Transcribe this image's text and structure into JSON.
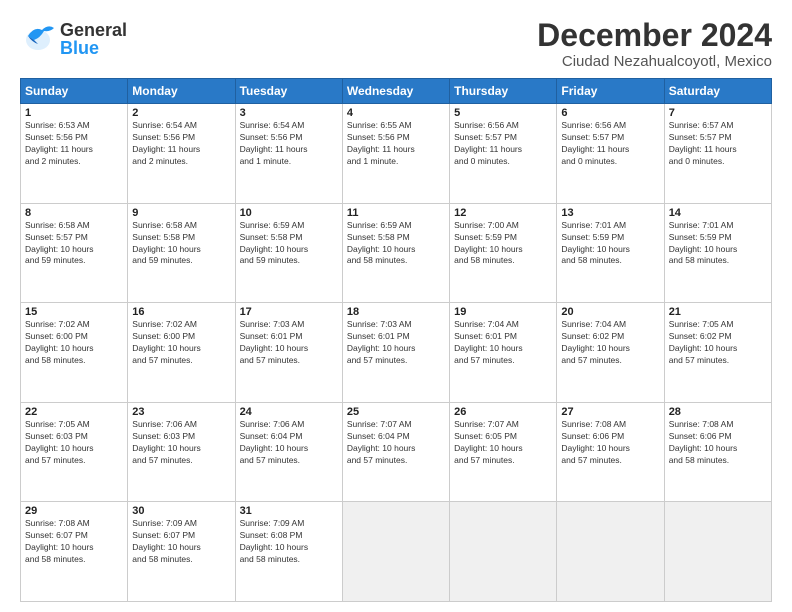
{
  "header": {
    "logo_general": "General",
    "logo_blue": "Blue",
    "main_title": "December 2024",
    "sub_title": "Ciudad Nezahualcoyotl, Mexico"
  },
  "calendar": {
    "headers": [
      "Sunday",
      "Monday",
      "Tuesday",
      "Wednesday",
      "Thursday",
      "Friday",
      "Saturday"
    ],
    "rows": [
      [
        {
          "day": "1",
          "info": "Sunrise: 6:53 AM\nSunset: 5:56 PM\nDaylight: 11 hours\nand 2 minutes."
        },
        {
          "day": "2",
          "info": "Sunrise: 6:54 AM\nSunset: 5:56 PM\nDaylight: 11 hours\nand 2 minutes."
        },
        {
          "day": "3",
          "info": "Sunrise: 6:54 AM\nSunset: 5:56 PM\nDaylight: 11 hours\nand 1 minute."
        },
        {
          "day": "4",
          "info": "Sunrise: 6:55 AM\nSunset: 5:56 PM\nDaylight: 11 hours\nand 1 minute."
        },
        {
          "day": "5",
          "info": "Sunrise: 6:56 AM\nSunset: 5:57 PM\nDaylight: 11 hours\nand 0 minutes."
        },
        {
          "day": "6",
          "info": "Sunrise: 6:56 AM\nSunset: 5:57 PM\nDaylight: 11 hours\nand 0 minutes."
        },
        {
          "day": "7",
          "info": "Sunrise: 6:57 AM\nSunset: 5:57 PM\nDaylight: 11 hours\nand 0 minutes."
        }
      ],
      [
        {
          "day": "8",
          "info": "Sunrise: 6:58 AM\nSunset: 5:57 PM\nDaylight: 10 hours\nand 59 minutes."
        },
        {
          "day": "9",
          "info": "Sunrise: 6:58 AM\nSunset: 5:58 PM\nDaylight: 10 hours\nand 59 minutes."
        },
        {
          "day": "10",
          "info": "Sunrise: 6:59 AM\nSunset: 5:58 PM\nDaylight: 10 hours\nand 59 minutes."
        },
        {
          "day": "11",
          "info": "Sunrise: 6:59 AM\nSunset: 5:58 PM\nDaylight: 10 hours\nand 58 minutes."
        },
        {
          "day": "12",
          "info": "Sunrise: 7:00 AM\nSunset: 5:59 PM\nDaylight: 10 hours\nand 58 minutes."
        },
        {
          "day": "13",
          "info": "Sunrise: 7:01 AM\nSunset: 5:59 PM\nDaylight: 10 hours\nand 58 minutes."
        },
        {
          "day": "14",
          "info": "Sunrise: 7:01 AM\nSunset: 5:59 PM\nDaylight: 10 hours\nand 58 minutes."
        }
      ],
      [
        {
          "day": "15",
          "info": "Sunrise: 7:02 AM\nSunset: 6:00 PM\nDaylight: 10 hours\nand 58 minutes."
        },
        {
          "day": "16",
          "info": "Sunrise: 7:02 AM\nSunset: 6:00 PM\nDaylight: 10 hours\nand 57 minutes."
        },
        {
          "day": "17",
          "info": "Sunrise: 7:03 AM\nSunset: 6:01 PM\nDaylight: 10 hours\nand 57 minutes."
        },
        {
          "day": "18",
          "info": "Sunrise: 7:03 AM\nSunset: 6:01 PM\nDaylight: 10 hours\nand 57 minutes."
        },
        {
          "day": "19",
          "info": "Sunrise: 7:04 AM\nSunset: 6:01 PM\nDaylight: 10 hours\nand 57 minutes."
        },
        {
          "day": "20",
          "info": "Sunrise: 7:04 AM\nSunset: 6:02 PM\nDaylight: 10 hours\nand 57 minutes."
        },
        {
          "day": "21",
          "info": "Sunrise: 7:05 AM\nSunset: 6:02 PM\nDaylight: 10 hours\nand 57 minutes."
        }
      ],
      [
        {
          "day": "22",
          "info": "Sunrise: 7:05 AM\nSunset: 6:03 PM\nDaylight: 10 hours\nand 57 minutes."
        },
        {
          "day": "23",
          "info": "Sunrise: 7:06 AM\nSunset: 6:03 PM\nDaylight: 10 hours\nand 57 minutes."
        },
        {
          "day": "24",
          "info": "Sunrise: 7:06 AM\nSunset: 6:04 PM\nDaylight: 10 hours\nand 57 minutes."
        },
        {
          "day": "25",
          "info": "Sunrise: 7:07 AM\nSunset: 6:04 PM\nDaylight: 10 hours\nand 57 minutes."
        },
        {
          "day": "26",
          "info": "Sunrise: 7:07 AM\nSunset: 6:05 PM\nDaylight: 10 hours\nand 57 minutes."
        },
        {
          "day": "27",
          "info": "Sunrise: 7:08 AM\nSunset: 6:06 PM\nDaylight: 10 hours\nand 57 minutes."
        },
        {
          "day": "28",
          "info": "Sunrise: 7:08 AM\nSunset: 6:06 PM\nDaylight: 10 hours\nand 58 minutes."
        }
      ],
      [
        {
          "day": "29",
          "info": "Sunrise: 7:08 AM\nSunset: 6:07 PM\nDaylight: 10 hours\nand 58 minutes."
        },
        {
          "day": "30",
          "info": "Sunrise: 7:09 AM\nSunset: 6:07 PM\nDaylight: 10 hours\nand 58 minutes."
        },
        {
          "day": "31",
          "info": "Sunrise: 7:09 AM\nSunset: 6:08 PM\nDaylight: 10 hours\nand 58 minutes."
        },
        {
          "day": "",
          "info": ""
        },
        {
          "day": "",
          "info": ""
        },
        {
          "day": "",
          "info": ""
        },
        {
          "day": "",
          "info": ""
        }
      ]
    ]
  }
}
